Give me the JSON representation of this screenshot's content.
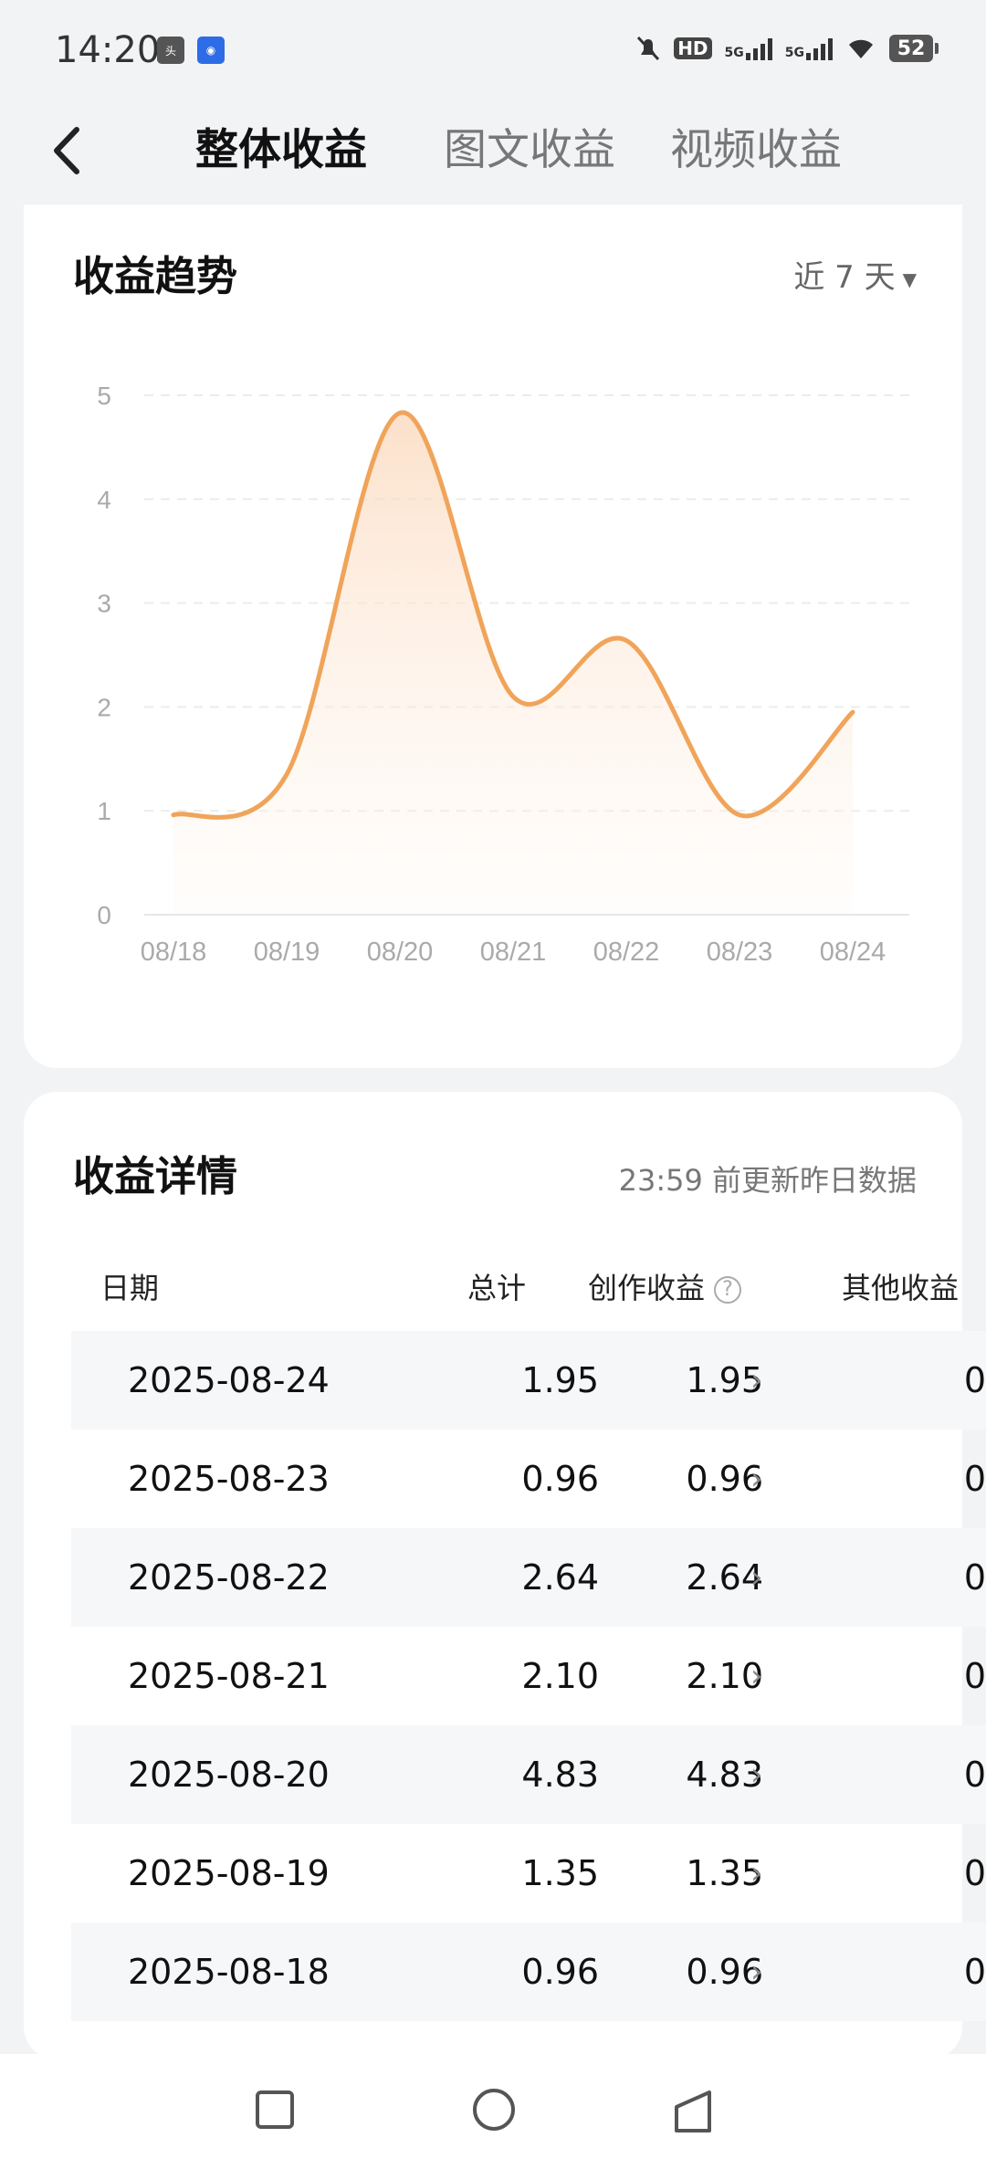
{
  "status_bar": {
    "time": "14:20",
    "app_icons": [
      "toutiao-icon",
      "baidu-icon"
    ],
    "indicators": [
      "mute-icon",
      "HD",
      "5G",
      "5G",
      "wifi-icon"
    ],
    "battery": "52"
  },
  "header": {
    "tabs": [
      {
        "label": "整体收益",
        "active": true
      },
      {
        "label": "图文收益",
        "active": false
      },
      {
        "label": "视频收益",
        "active": false
      }
    ]
  },
  "trend": {
    "title": "收益趋势",
    "range_label": "近 7 天"
  },
  "chart_data": {
    "type": "area",
    "title": "收益趋势",
    "x": [
      "08/18",
      "08/19",
      "08/20",
      "08/21",
      "08/22",
      "08/23",
      "08/24"
    ],
    "values": [
      0.96,
      1.35,
      4.83,
      2.1,
      2.64,
      0.96,
      1.95
    ],
    "y_ticks": [
      "0",
      "1",
      "2",
      "3",
      "4",
      "5"
    ],
    "ylim": [
      0,
      5
    ],
    "grid": "dashed horizontal",
    "line_color": "#f0a45a",
    "fill_color": "#fde3cc"
  },
  "details": {
    "title": "收益详情",
    "update_note": "23:59 前更新昨日数据",
    "headers": {
      "date": "日期",
      "total": "总计",
      "creation": "创作收益",
      "other": "其他收益"
    },
    "rows": [
      {
        "date": "2025-08-24",
        "total": "1.95",
        "creation": "1.95",
        "other": "0"
      },
      {
        "date": "2025-08-23",
        "total": "0.96",
        "creation": "0.96",
        "other": "0"
      },
      {
        "date": "2025-08-22",
        "total": "2.64",
        "creation": "2.64",
        "other": "0"
      },
      {
        "date": "2025-08-21",
        "total": "2.10",
        "creation": "2.10",
        "other": "0"
      },
      {
        "date": "2025-08-20",
        "total": "4.83",
        "creation": "4.83",
        "other": "0"
      },
      {
        "date": "2025-08-19",
        "total": "1.35",
        "creation": "1.35",
        "other": "0"
      },
      {
        "date": "2025-08-18",
        "total": "0.96",
        "creation": "0.96",
        "other": "0"
      }
    ]
  },
  "nav_bar": [
    "recents-icon",
    "home-icon",
    "back-icon"
  ]
}
